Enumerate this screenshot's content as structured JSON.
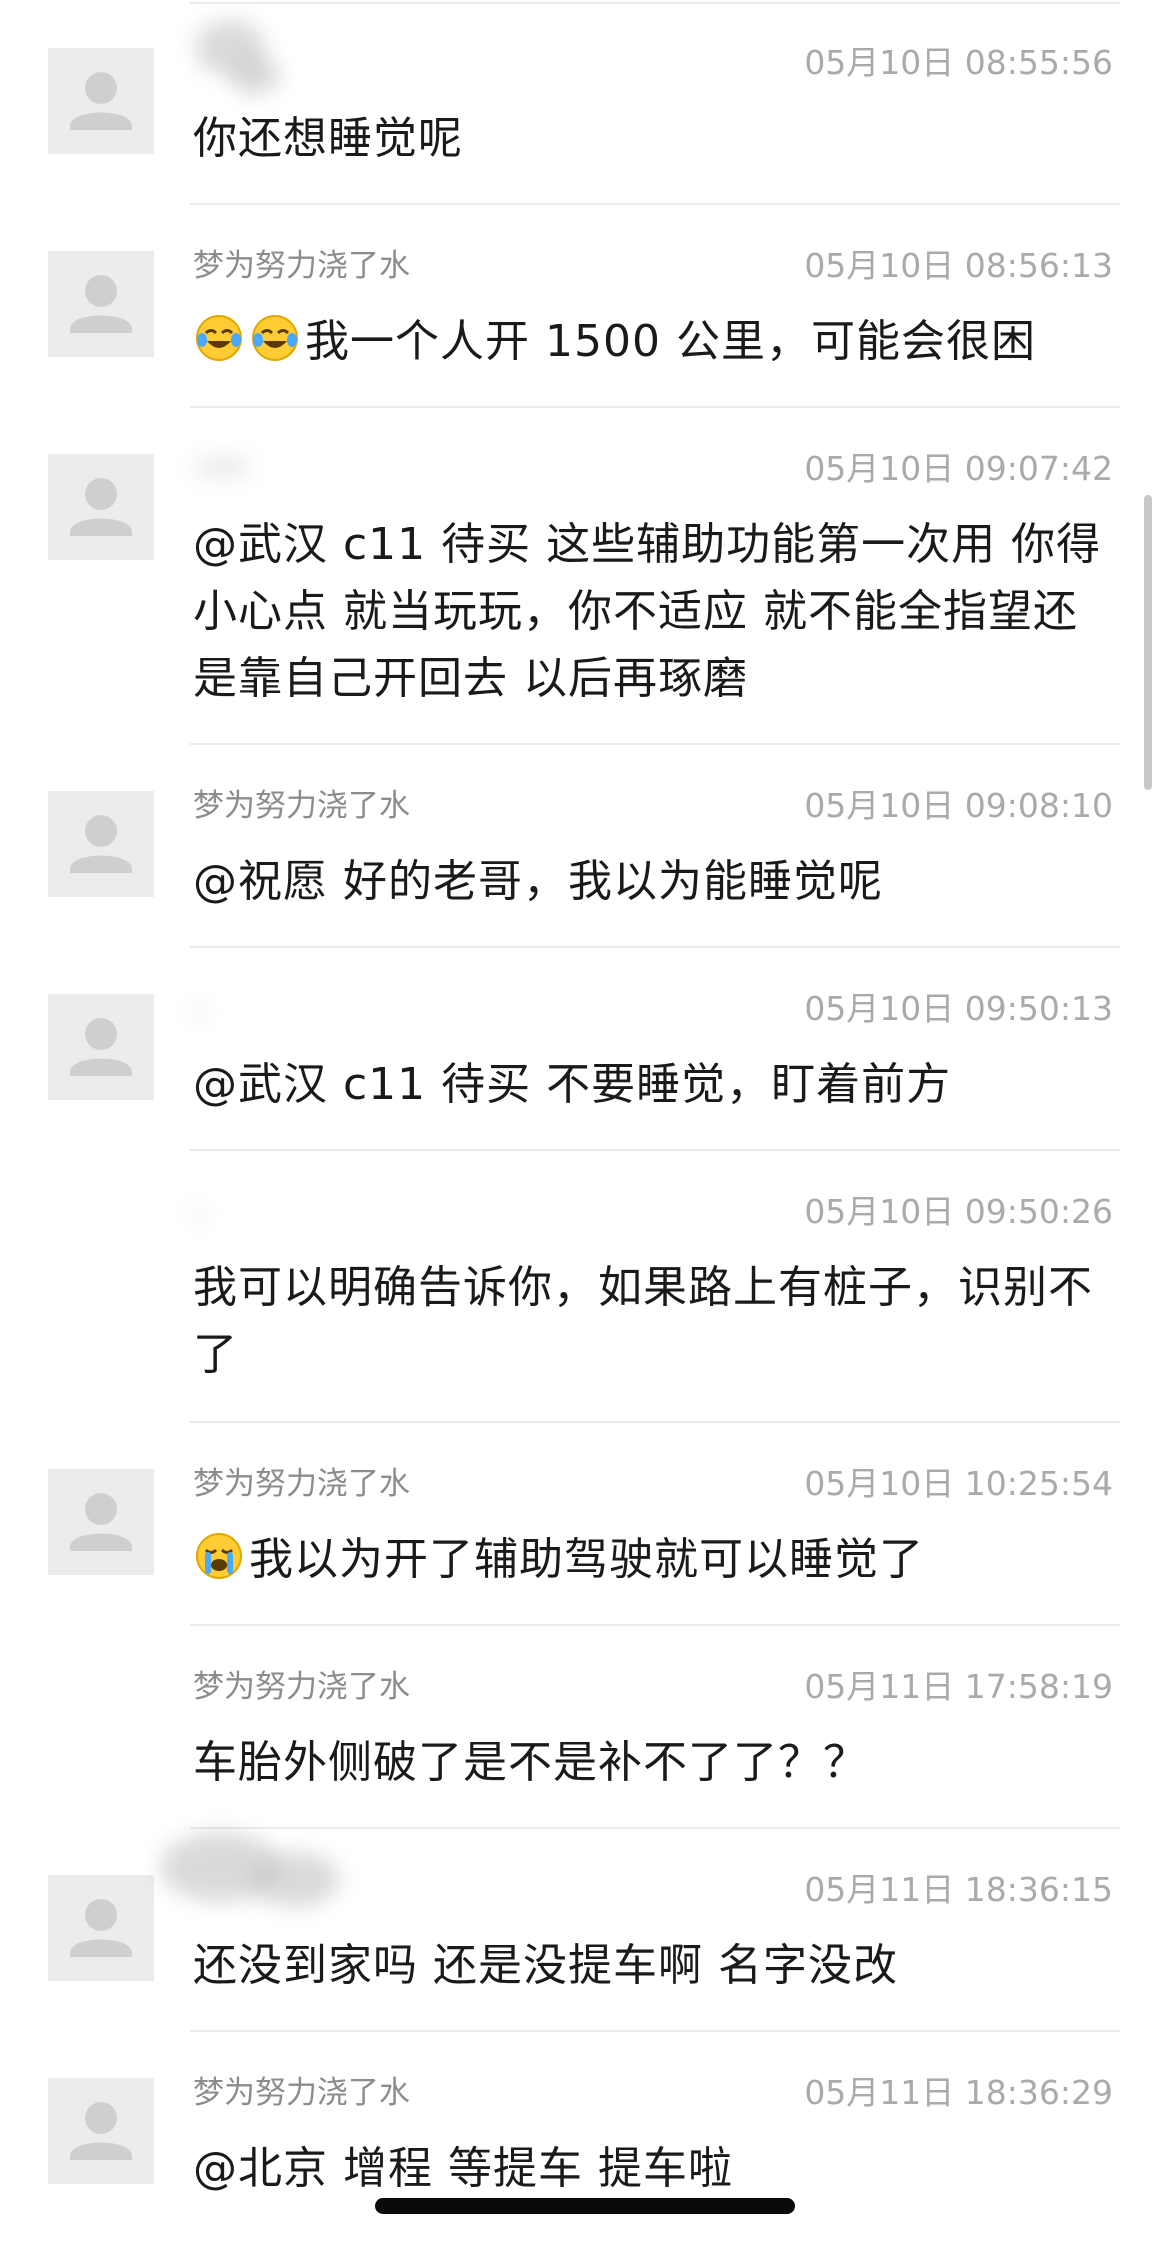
{
  "comments": [
    {
      "name": "",
      "time": "05月10日 08:55:56",
      "text": "你还想睡觉呢",
      "emoji": []
    },
    {
      "name": "梦为努力浇了水",
      "time": "05月10日 08:56:13",
      "text": "我一个人开 1500 公里，可能会很困",
      "emoji": [
        "face-with-tears-of-joy-icon",
        "face-with-tears-of-joy-icon"
      ]
    },
    {
      "name": "",
      "time": "05月10日 09:07:42",
      "text": "@武汉 c11 待买 这些辅助功能第一次用 你得小心点 就当玩玩，你不适应 就不能全指望还是靠自己开回去 以后再琢磨",
      "emoji": []
    },
    {
      "name": "梦为努力浇了水",
      "time": "05月10日 09:08:10",
      "text": "@祝愿 好的老哥，我以为能睡觉呢",
      "emoji": []
    },
    {
      "name": "",
      "time": "05月10日 09:50:13",
      "text": "@武汉 c11 待买 不要睡觉，盯着前方",
      "emoji": []
    },
    {
      "name": "",
      "time": "05月10日 09:50:26",
      "text": "我可以明确告诉你，如果路上有桩子，识别不了",
      "emoji": []
    },
    {
      "name": "梦为努力浇了水",
      "time": "05月10日 10:25:54",
      "text": "我以为开了辅助驾驶就可以睡觉了",
      "emoji": [
        "loudly-crying-face-icon"
      ]
    },
    {
      "name": "梦为努力浇了水",
      "time": "05月11日 17:58:19",
      "text": "车胎外侧破了是不是补不了了？？",
      "emoji": []
    },
    {
      "name": "",
      "time": "05月11日 18:36:15",
      "text": "还没到家吗 还是没提车啊 名字没改",
      "emoji": []
    },
    {
      "name": "梦为努力浇了水",
      "time": "05月11日 18:36:29",
      "text": "@北京 增程 等提车 提车啦",
      "emoji": []
    }
  ],
  "colors": {
    "name": "#8c8c8c",
    "time": "#aaaaaa",
    "text": "#1a1a1a",
    "avatar_bg": "#ececec",
    "avatar_fg": "#cfcfcf"
  }
}
